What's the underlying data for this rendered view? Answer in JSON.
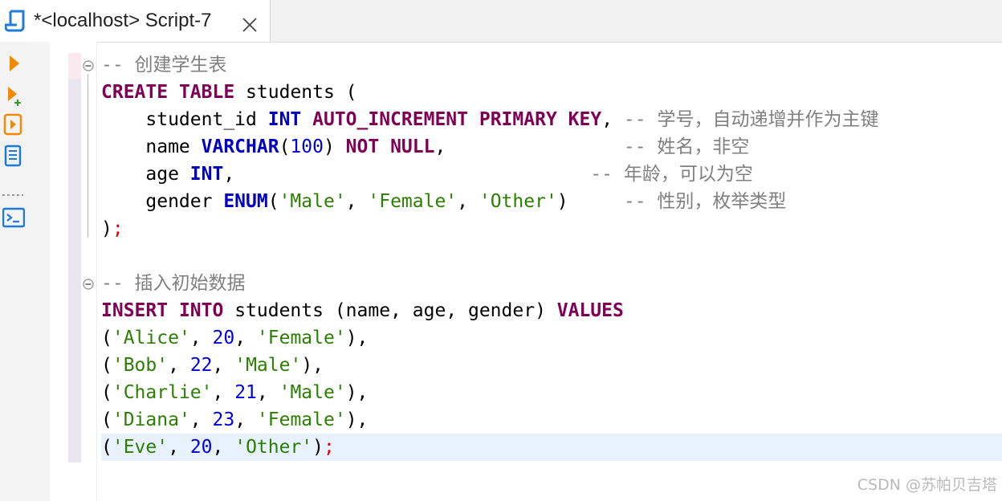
{
  "tab": {
    "title": "*<localhost> Script-7",
    "icon": "sql-script-icon",
    "close_icon": "close-icon"
  },
  "toolbar": {
    "items": [
      {
        "name": "execute-statement-icon",
        "color": "#f08a00"
      },
      {
        "name": "execute-in-new-tab-icon",
        "color": "#f08a00"
      },
      {
        "name": "execute-script-icon",
        "color": "#f08a00"
      },
      {
        "name": "explain-plan-icon",
        "color": "#1e7bd8"
      },
      {
        "name": "open-console-icon",
        "color": "#1e7bd8"
      }
    ]
  },
  "editor": {
    "lines": [
      [
        {
          "t": "-- 创建学生表",
          "c": "cmt"
        }
      ],
      [
        {
          "t": "CREATE",
          "c": "kw"
        },
        {
          "t": " "
        },
        {
          "t": "TABLE",
          "c": "kw"
        },
        {
          "t": " students ("
        }
      ],
      [
        {
          "t": "    student_id "
        },
        {
          "t": "INT",
          "c": "ty"
        },
        {
          "t": " "
        },
        {
          "t": "AUTO_INCREMENT",
          "c": "kw"
        },
        {
          "t": " "
        },
        {
          "t": "PRIMARY",
          "c": "kw"
        },
        {
          "t": " "
        },
        {
          "t": "KEY",
          "c": "kw"
        },
        {
          "t": ", "
        },
        {
          "t": "-- 学号，自动递增并作为主键",
          "c": "cmt"
        }
      ],
      [
        {
          "t": "    name "
        },
        {
          "t": "VARCHAR",
          "c": "ty"
        },
        {
          "t": "("
        },
        {
          "t": "100",
          "c": "num"
        },
        {
          "t": ") "
        },
        {
          "t": "NOT",
          "c": "kw"
        },
        {
          "t": " "
        },
        {
          "t": "NULL",
          "c": "kw"
        },
        {
          "t": ",                "
        },
        {
          "t": "-- 姓名，非空",
          "c": "cmt"
        }
      ],
      [
        {
          "t": "    age "
        },
        {
          "t": "INT",
          "c": "ty"
        },
        {
          "t": ",                                "
        },
        {
          "t": "-- 年龄，可以为空",
          "c": "cmt"
        }
      ],
      [
        {
          "t": "    gender "
        },
        {
          "t": "ENUM",
          "c": "ty"
        },
        {
          "t": "("
        },
        {
          "t": "'Male'",
          "c": "str"
        },
        {
          "t": ", "
        },
        {
          "t": "'Female'",
          "c": "str"
        },
        {
          "t": ", "
        },
        {
          "t": "'Other'",
          "c": "str"
        },
        {
          "t": ")     "
        },
        {
          "t": "-- 性别，枚举类型",
          "c": "cmt"
        }
      ],
      [
        {
          "t": ")"
        },
        {
          "t": ";",
          "c": "semi"
        }
      ],
      [],
      [
        {
          "t": "-- 插入初始数据",
          "c": "cmt"
        }
      ],
      [
        {
          "t": "INSERT",
          "c": "kw"
        },
        {
          "t": " "
        },
        {
          "t": "INTO",
          "c": "kw"
        },
        {
          "t": " students (name, age, gender) "
        },
        {
          "t": "VALUES",
          "c": "kw"
        }
      ],
      [
        {
          "t": "("
        },
        {
          "t": "'Alice'",
          "c": "str"
        },
        {
          "t": ", "
        },
        {
          "t": "20",
          "c": "num"
        },
        {
          "t": ", "
        },
        {
          "t": "'Female'",
          "c": "str"
        },
        {
          "t": "),"
        }
      ],
      [
        {
          "t": "("
        },
        {
          "t": "'Bob'",
          "c": "str"
        },
        {
          "t": ", "
        },
        {
          "t": "22",
          "c": "num"
        },
        {
          "t": ", "
        },
        {
          "t": "'Male'",
          "c": "str"
        },
        {
          "t": "),"
        }
      ],
      [
        {
          "t": "("
        },
        {
          "t": "'Charlie'",
          "c": "str"
        },
        {
          "t": ", "
        },
        {
          "t": "21",
          "c": "num"
        },
        {
          "t": ", "
        },
        {
          "t": "'Male'",
          "c": "str"
        },
        {
          "t": "),"
        }
      ],
      [
        {
          "t": "("
        },
        {
          "t": "'Diana'",
          "c": "str"
        },
        {
          "t": ", "
        },
        {
          "t": "23",
          "c": "num"
        },
        {
          "t": ", "
        },
        {
          "t": "'Female'",
          "c": "str"
        },
        {
          "t": "),"
        }
      ],
      [
        {
          "t": "("
        },
        {
          "t": "'Eve'",
          "c": "str"
        },
        {
          "t": ", "
        },
        {
          "t": "20",
          "c": "num"
        },
        {
          "t": ", "
        },
        {
          "t": "'Other'",
          "c": "str"
        },
        {
          "t": ")"
        },
        {
          "t": ";",
          "c": "semi"
        }
      ]
    ],
    "current_line": 14,
    "colors": {
      "keyword": "#7f0055",
      "type": "#0000c0",
      "string": "#2a7f00",
      "number": "#0000dd",
      "comment": "#808080",
      "current_line_bg": "#e8f2fe"
    }
  },
  "watermark": "CSDN @苏帕贝吉塔"
}
